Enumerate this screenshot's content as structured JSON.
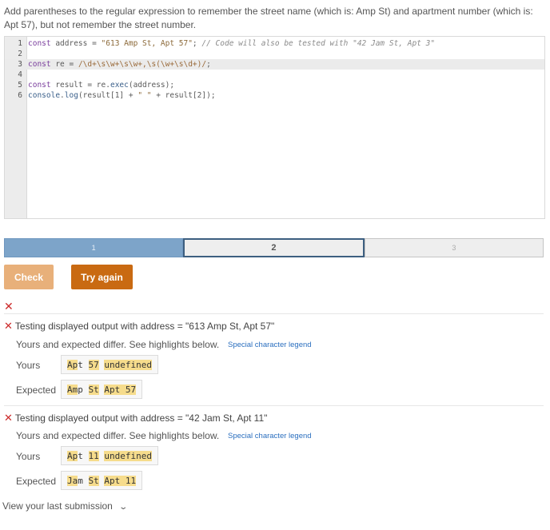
{
  "instructions": "Add parentheses to the regular expression to remember the street name (which is: Amp St) and apartment number (which is: Apt 57), but not remember the street number.",
  "editor": {
    "line_numbers": [
      "1",
      "2",
      "3",
      "4",
      "5",
      "6"
    ],
    "lines": [
      {
        "parts": [
          {
            "t": "const",
            "c": "kw"
          },
          {
            "t": " address = ",
            "c": ""
          },
          {
            "t": "\"613 Amp St, Apt 57\"",
            "c": "str"
          },
          {
            "t": "; ",
            "c": ""
          },
          {
            "t": "// Code will also be tested with \"42 Jam St, Apt 3\"",
            "c": "cm"
          }
        ]
      },
      {
        "parts": []
      },
      {
        "parts": [
          {
            "t": "const",
            "c": "kw"
          },
          {
            "t": " re = ",
            "c": ""
          },
          {
            "t": "/\\d+\\s\\w+\\s\\w+,\\s(\\w+\\s\\d+)/",
            "c": "re"
          },
          {
            "t": ";",
            "c": ""
          }
        ]
      },
      {
        "parts": []
      },
      {
        "parts": [
          {
            "t": "const",
            "c": "kw"
          },
          {
            "t": " result = re.",
            "c": ""
          },
          {
            "t": "exec",
            "c": "fn"
          },
          {
            "t": "(address);",
            "c": ""
          }
        ]
      },
      {
        "parts": [
          {
            "t": "console",
            "c": "fn"
          },
          {
            "t": ".",
            "c": ""
          },
          {
            "t": "log",
            "c": "fn"
          },
          {
            "t": "(result[1] + ",
            "c": ""
          },
          {
            "t": "\" \"",
            "c": "str"
          },
          {
            "t": " + result[2]);",
            "c": ""
          }
        ]
      }
    ],
    "active_line": 3
  },
  "progress": {
    "steps": [
      "1",
      "2",
      "3"
    ],
    "current": 2
  },
  "buttons": {
    "check": "Check",
    "try_again": "Try again"
  },
  "icons": {
    "fail": "x-icon",
    "chevron": "chevron-down-icon"
  },
  "colors": {
    "fail": "#cc2a2a",
    "check_button": "#e8b07a",
    "try_button": "#c96a12",
    "highlight": "#f6dc8c",
    "progress_done": "#7da4c9"
  },
  "tests": [
    {
      "title": "Testing displayed output with address = \"613 Amp St, Apt 57\"",
      "status": "Yours and expected differ. See highlights below.",
      "legend": "Special character legend",
      "yours_label": "Yours",
      "yours": [
        {
          "t": "Ap",
          "h": true
        },
        {
          "t": "t",
          "h": false
        },
        {
          "t": " ",
          "h": false
        },
        {
          "t": "57",
          "h": true
        },
        {
          "t": " ",
          "h": false
        },
        {
          "t": "undefined",
          "h": true
        }
      ],
      "expected_label": "Expected",
      "expected": [
        {
          "t": "Am",
          "h": true
        },
        {
          "t": "p",
          "h": false
        },
        {
          "t": " ",
          "h": false
        },
        {
          "t": "St",
          "h": true
        },
        {
          "t": " ",
          "h": false
        },
        {
          "t": "Apt 57",
          "h": true
        }
      ]
    },
    {
      "title": "Testing displayed output with address = \"42 Jam St, Apt 11\"",
      "status": "Yours and expected differ. See highlights below.",
      "legend": "Special character legend",
      "yours_label": "Yours",
      "yours": [
        {
          "t": "Ap",
          "h": true
        },
        {
          "t": "t",
          "h": false
        },
        {
          "t": " ",
          "h": false
        },
        {
          "t": "11",
          "h": true
        },
        {
          "t": " ",
          "h": false
        },
        {
          "t": "undefined",
          "h": true
        }
      ],
      "expected_label": "Expected",
      "expected": [
        {
          "t": "Ja",
          "h": true
        },
        {
          "t": "m",
          "h": false
        },
        {
          "t": " ",
          "h": false
        },
        {
          "t": "St",
          "h": true
        },
        {
          "t": " ",
          "h": false
        },
        {
          "t": "Apt 11",
          "h": true
        }
      ]
    }
  ],
  "view_last": "View your last submission"
}
